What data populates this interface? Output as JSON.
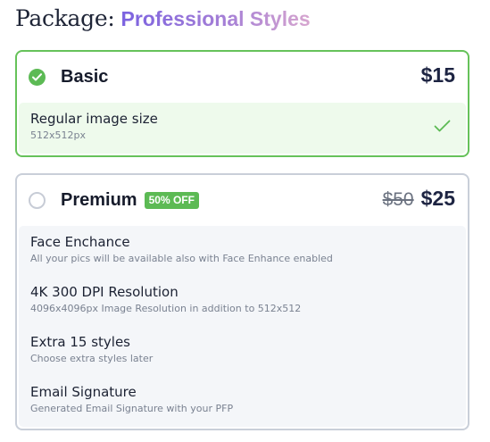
{
  "header": {
    "prefix": "Package:",
    "highlight": "Professional Styles"
  },
  "plans": {
    "basic": {
      "name": "Basic",
      "price": "$15",
      "selected": true,
      "features": [
        {
          "title": "Regular image size",
          "subtitle": "512x512px",
          "check_icon": "checkmark-icon"
        }
      ]
    },
    "premium": {
      "name": "Premium",
      "badge": "50% OFF",
      "old_price": "$50",
      "price": "$25",
      "selected": false,
      "features": [
        {
          "title": "Face Enchance",
          "subtitle": "All your pics will be available also with Face Enhance enabled"
        },
        {
          "title": "4K 300 DPI Resolution",
          "subtitle": "4096x4096px Image Resolution in addition to 512x512"
        },
        {
          "title": "Extra 15 styles",
          "subtitle": "Choose extra styles later"
        },
        {
          "title": "Email Signature",
          "subtitle": "Generated Email Signature with your PFP"
        }
      ]
    }
  },
  "colors": {
    "accent_green": "#5cba54",
    "gradient_start": "#7b62e0",
    "gradient_end": "#d7a6cf",
    "price_text": "#1d2442"
  }
}
